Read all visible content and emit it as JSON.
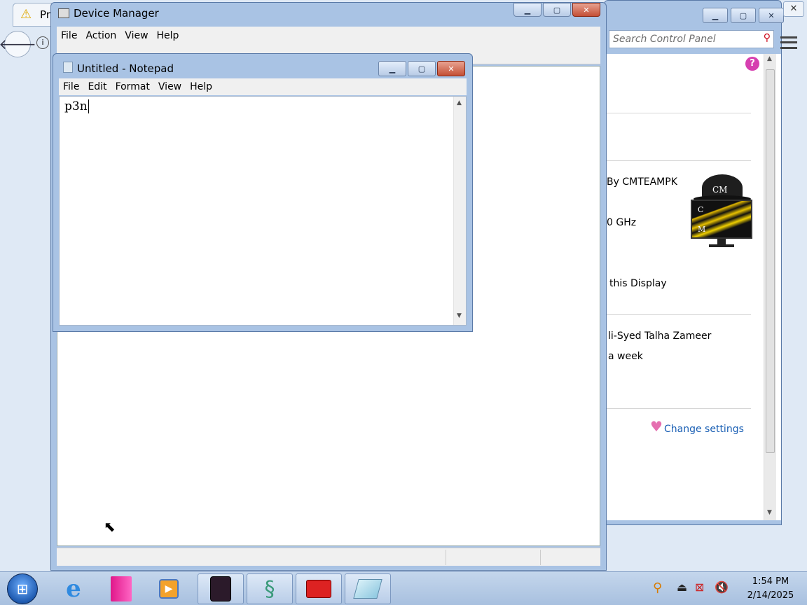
{
  "browser": {
    "tab_title": "Pr",
    "search_placeholder": "Search Control Panel"
  },
  "control_panel": {
    "items": [
      "By CMTEAMPK",
      "0 GHz",
      "this Display",
      "li-Syed Talha Zameer",
      "a week"
    ],
    "change_settings": "Change settings",
    "logo_letters": {
      "top": "CM",
      "c": "C",
      "m": "M"
    }
  },
  "device_manager": {
    "title": "Device Manager",
    "menu": [
      "File",
      "Action",
      "View",
      "Help"
    ]
  },
  "notepad": {
    "title": "Untitled - Notepad",
    "menu": [
      "File",
      "Edit",
      "Format",
      "View",
      "Help"
    ],
    "content": "p3n"
  },
  "window_controls": {
    "minimize": "▁",
    "maximize": "▢",
    "close": "✕"
  },
  "taskbar": {
    "time": "1:54 PM",
    "date": "2/14/2025"
  },
  "colors": {
    "frame": "#a9c3e4",
    "link": "#1a5fb4",
    "close": "#c44f35"
  }
}
